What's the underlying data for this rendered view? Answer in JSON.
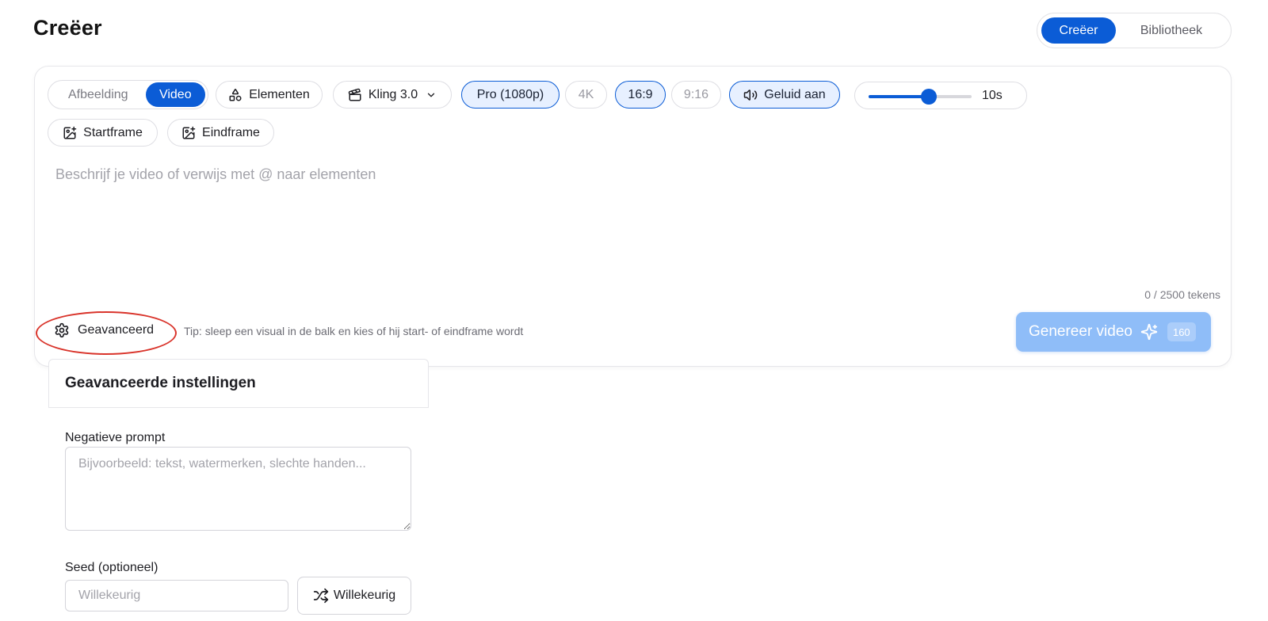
{
  "page": {
    "title": "Creëer"
  },
  "view_toggle": {
    "create_label": "Creëer",
    "library_label": "Bibliotheek",
    "active": "create"
  },
  "composer": {
    "mode": {
      "image_label": "Afbeelding",
      "video_label": "Video",
      "selected": "video"
    },
    "elements_label": "Elementen",
    "model_label": "Kling 3.0",
    "quality": {
      "pro_label": "Pro (1080p)",
      "k4_label": "4K",
      "selected": "pro"
    },
    "aspect": {
      "wide_label": "16:9",
      "tall_label": "9:16",
      "selected": "16:9"
    },
    "sound_label": "Geluid aan",
    "duration": {
      "label": "10s",
      "value": 10,
      "min": 3,
      "max": 15
    },
    "start_frame_label": "Startframe",
    "end_frame_label": "Eindframe",
    "prompt": {
      "value": "",
      "placeholder": "Beschrijf je video of verwijs met @ naar elementen"
    },
    "char_count": "0 / 2500 tekens",
    "advanced_label": "Geavanceerd",
    "tip": "Tip: sleep een visual in de balk en kies of hij start- of eindframe wordt",
    "generate_label": "Genereer video",
    "generate_credits": "160"
  },
  "advanced_panel": {
    "title": "Geavanceerde instellingen",
    "negative_prompt_label": "Negatieve prompt",
    "negative_prompt_value": "",
    "negative_prompt_placeholder": "Bijvoorbeeld: tekst, watermerken, slechte handen...",
    "seed_label": "Seed (optioneel)",
    "seed_value": "",
    "seed_placeholder": "Willekeurig",
    "random_label": "Willekeurig"
  },
  "colors": {
    "accent": "#0b5cd6",
    "accent_light": "#e7f0ff",
    "generate_disabled": "#8fbdf8",
    "highlight": "#d9342b"
  },
  "icons": {
    "elements": "shapes-icon",
    "model": "clapperboard-icon",
    "sound": "speaker-icon",
    "start_frame": "image-plus-icon",
    "end_frame": "image-plus-icon",
    "advanced": "gear-icon",
    "generate": "sparkles-icon",
    "random": "shuffle-icon"
  }
}
